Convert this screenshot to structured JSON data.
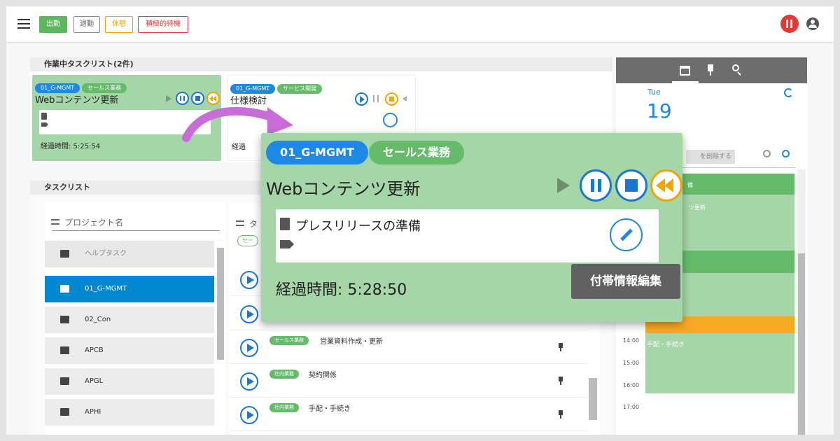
{
  "status_buttons": [
    {
      "label": "出勤",
      "color": "#4caf50"
    },
    {
      "label": "退勤",
      "color": "#757575"
    },
    {
      "label": "休憩",
      "color": "#f0a500"
    },
    {
      "label": "積極的待機",
      "color": "#e53935"
    }
  ],
  "active_panel": {
    "title": "作業中タスクリスト(2件)",
    "cards": [
      {
        "tags": [
          "01_G-MGMT",
          "セールス業務"
        ],
        "title": "Webコンテンツ更新",
        "elapsed": "経過時間: 5:25:54"
      },
      {
        "tags": [
          "01_G-MGMT",
          "サービス開発"
        ],
        "title": "仕様検討",
        "elapsed": "経過"
      }
    ]
  },
  "task_panel": {
    "title": "タスクリスト",
    "project_filter_placeholder": "プロジェクト名",
    "task_filter_placeholder": "タ",
    "chip_partial": "セー",
    "projects": [
      {
        "label": "ヘルプタスク",
        "selected": false
      },
      {
        "label": "01_G-MGMT",
        "selected": true
      },
      {
        "label": "02_Con",
        "selected": false
      },
      {
        "label": "APCB",
        "selected": false
      },
      {
        "label": "APGL",
        "selected": false
      },
      {
        "label": "APHI",
        "selected": false
      }
    ],
    "tasks": [
      {
        "tag": "",
        "name": ""
      },
      {
        "tag": "",
        "name": ""
      },
      {
        "tag": "セールス業務",
        "name": "営業資料作成・更新"
      },
      {
        "tag": "社内業務",
        "name": "契約関係"
      },
      {
        "tag": "社内業務",
        "name": "手配・手続き"
      }
    ]
  },
  "calendar": {
    "day_name": "Tue",
    "day_number": "19",
    "delete_button": "を削除する",
    "times": [
      "14:00",
      "15:00",
      "16:00",
      "17:00"
    ],
    "events": [
      {
        "label": "備"
      },
      {
        "label": "ツ更新"
      },
      {
        "label": ""
      },
      {
        "label": ""
      },
      {
        "label": "手配・手続き"
      }
    ]
  },
  "popup": {
    "tags": [
      "01_G-MGMT",
      "セールス業務"
    ],
    "title": "Webコンテンツ更新",
    "note": "プレスリリースの準備",
    "elapsed": "経過時間: 5:28:50",
    "tooltip": "付帯情報編集"
  },
  "colors": {
    "accent": "#1976d2",
    "card_green": "#a5d6a7",
    "chip_blue": "#1e88e5",
    "chip_green": "#66bb6a",
    "selected_item": "#0288d1",
    "rewind": "#f0a500",
    "arrow": "#c86dd7"
  }
}
